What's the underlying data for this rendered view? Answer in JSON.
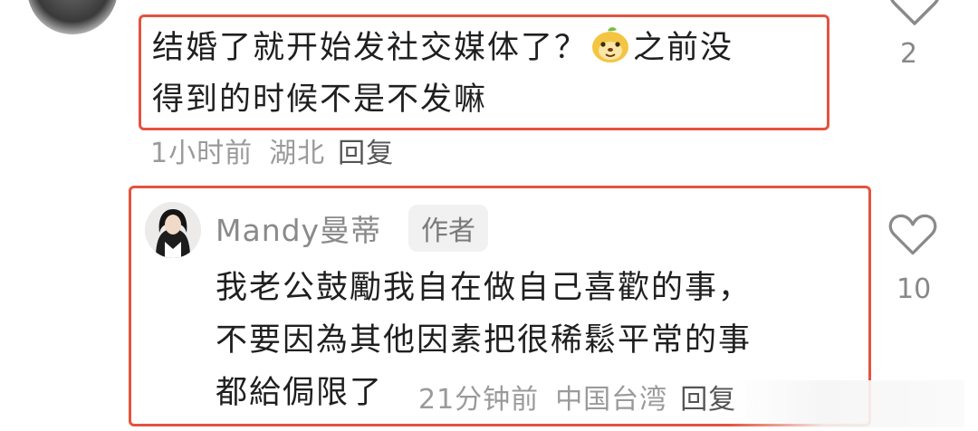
{
  "comment1": {
    "text_before_emoji": "结婚了就开始发社交媒体了？",
    "emoji": "meme-face-emoji",
    "text_after_emoji": "之前没",
    "line2": "得到的时候不是不发嘛",
    "time": "1小时前",
    "location": "湖北",
    "reply": "回复",
    "likes": "2"
  },
  "comment2": {
    "username": "Mandy曼蒂",
    "badge": "作者",
    "line1": "我老公鼓勵我自在做自己喜歡的事，",
    "line2": "不要因為其他因素把很稀鬆平常的事",
    "line3": "都給侷限了",
    "time": "21分钟前",
    "location": "中国台湾",
    "reply": "回复",
    "likes": "10"
  },
  "colors": {
    "highlight_border": "#e4533f",
    "meta_text": "#9a9a9a",
    "body_text": "#1f1f1f"
  }
}
